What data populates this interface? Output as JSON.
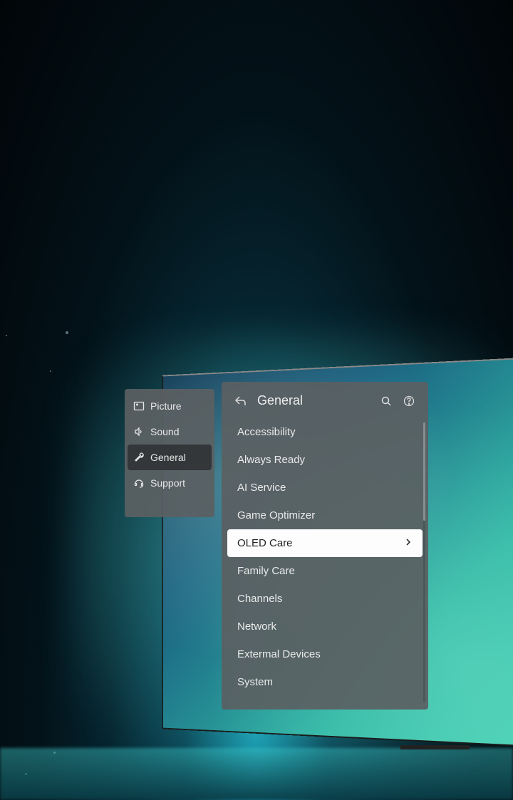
{
  "sidebar": {
    "items": [
      {
        "label": "Picture",
        "icon": "picture-icon",
        "selected": false
      },
      {
        "label": "Sound",
        "icon": "sound-icon",
        "selected": false
      },
      {
        "label": "General",
        "icon": "wrench-icon",
        "selected": true
      },
      {
        "label": "Support",
        "icon": "headset-icon",
        "selected": false
      }
    ]
  },
  "panel": {
    "title": "General",
    "back_label": "Back",
    "search_label": "Search",
    "help_label": "Help",
    "items": [
      {
        "label": "Accessibility",
        "selected": false
      },
      {
        "label": "Always Ready",
        "selected": false
      },
      {
        "label": "AI Service",
        "selected": false
      },
      {
        "label": "Game Optimizer",
        "selected": false
      },
      {
        "label": "OLED Care",
        "selected": true
      },
      {
        "label": "Family Care",
        "selected": false
      },
      {
        "label": "Channels",
        "selected": false
      },
      {
        "label": "Network",
        "selected": false
      },
      {
        "label": "Extermal Devices",
        "selected": false
      },
      {
        "label": "System",
        "selected": false
      }
    ]
  }
}
